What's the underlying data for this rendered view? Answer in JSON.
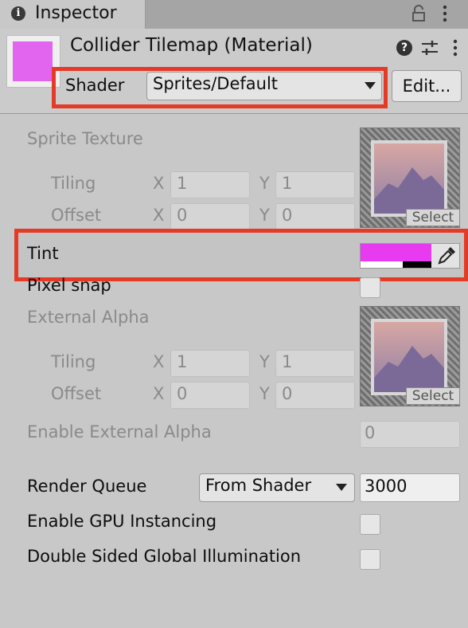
{
  "tab": {
    "title": "Inspector",
    "icon": "info-icon"
  },
  "header": {
    "title": "Collider Tilemap (Material)",
    "swatch_color": "#e165ee",
    "shader_label": "Shader",
    "shader_value": "Sprites/Default",
    "edit_label": "Edit..."
  },
  "properties": {
    "sprite_texture": {
      "label": "Sprite Texture",
      "tiling_label": "Tiling",
      "offset_label": "Offset",
      "x": "X",
      "y": "Y",
      "tiling_x": "1",
      "tiling_y": "1",
      "offset_x": "0",
      "offset_y": "0",
      "select_label": "Select"
    },
    "tint": {
      "label": "Tint",
      "color": "#e83af0",
      "alpha": 0.6
    },
    "pixel_snap": {
      "label": "Pixel snap",
      "checked": false
    },
    "external_alpha": {
      "label": "External Alpha",
      "tiling_label": "Tiling",
      "offset_label": "Offset",
      "x": "X",
      "y": "Y",
      "tiling_x": "1",
      "tiling_y": "1",
      "offset_x": "0",
      "offset_y": "0",
      "select_label": "Select"
    },
    "enable_external_alpha": {
      "label": "Enable External Alpha",
      "value": "0"
    },
    "render_queue": {
      "label": "Render Queue",
      "mode": "From Shader",
      "value": "3000"
    },
    "gpu_instancing": {
      "label": "Enable GPU Instancing",
      "checked": false
    },
    "double_sided_gi": {
      "label": "Double Sided Global Illumination",
      "checked": false
    }
  },
  "highlight_color": "#e53a26"
}
